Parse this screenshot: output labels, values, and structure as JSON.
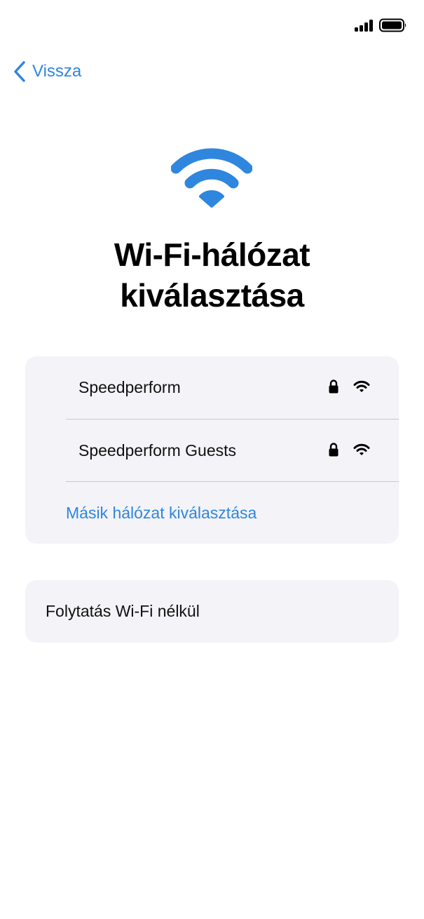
{
  "status_bar": {
    "signal_icon": "cellular-signal-icon",
    "battery_icon": "battery-icon"
  },
  "navigation": {
    "back_label": "Vissza",
    "back_icon": "chevron-left-icon"
  },
  "hero": {
    "icon": "wifi-icon",
    "title_line1": "Wi-Fi-hálózat",
    "title_line2": "kiválasztása"
  },
  "networks": [
    {
      "name": "Speedperform",
      "secured": true,
      "lock_icon": "lock-icon",
      "signal_icon": "wifi-signal-icon"
    },
    {
      "name": "Speedperform Guests",
      "secured": true,
      "lock_icon": "lock-icon",
      "signal_icon": "wifi-signal-icon"
    }
  ],
  "other_network_label": "Másik hálózat kiválasztása",
  "continue_without_wifi_label": "Folytatás Wi-Fi nélkül",
  "colors": {
    "accent": "#2f86df",
    "card_background": "#f3f3f8",
    "divider": "#c9c9ce"
  }
}
